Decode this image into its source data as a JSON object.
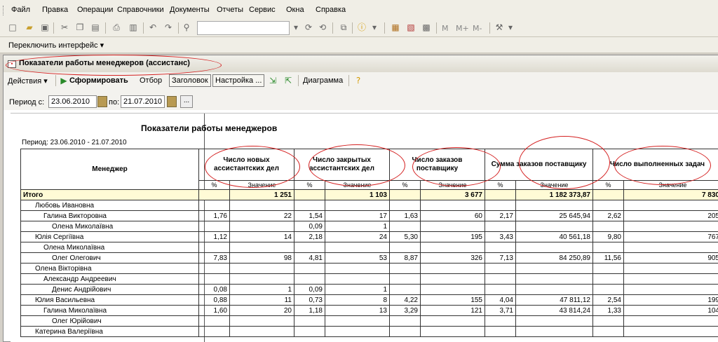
{
  "menu": [
    "Файл",
    "Правка",
    "Операции",
    "Справочники",
    "Документы",
    "Отчеты",
    "Сервис",
    "Окна",
    "Справка"
  ],
  "toolbar": {
    "search_value": "",
    "text_buttons": [
      "M",
      "M+",
      "M-"
    ]
  },
  "switch_interface": "Переключить интерфейс",
  "window": {
    "title": "Показатели работы менеджеров (ассистанс)",
    "actions": {
      "actions_label": "Действия",
      "generate": "Сформировать",
      "filter": "Отбор",
      "header": "Заголовок",
      "settings": "Настройка ...",
      "chart": "Диаграмма"
    },
    "period": {
      "from_label": "Период с:",
      "from": "23.06.2010",
      "to_label": "по:",
      "to": "21.07.2010",
      "more": "..."
    }
  },
  "report": {
    "title": "Показатели работы менеджеров",
    "period": "Период: 23.06.2010 - 21.07.2010",
    "manager_header": "Менеджер",
    "groups": [
      "Число новых ассистантских дел",
      "Число закрытых ассистантских дел",
      "Число заказов поставщику",
      "Сумма заказов поставщику",
      "Число выполненных задач"
    ],
    "sub_pct": "%",
    "sub_val": "Значение",
    "total_label": "Итого",
    "total": [
      "",
      "1 251",
      "",
      "1 103",
      "",
      "3 677",
      "",
      "1 182 373,87",
      "",
      "7 830"
    ],
    "rows": [
      {
        "name": "Любовь Ивановна",
        "v": [
          "",
          "",
          "",
          "",
          "",
          "",
          "",
          "",
          "",
          ""
        ]
      },
      {
        "name": "Галина Викторовна",
        "v": [
          "1,76",
          "22",
          "1,54",
          "17",
          "1,63",
          "60",
          "2,17",
          "25 645,94",
          "2,62",
          "205"
        ]
      },
      {
        "name": "Олена Миколаївна",
        "v": [
          "",
          "",
          "0,09",
          "1",
          "",
          "",
          "",
          "",
          "",
          ""
        ]
      },
      {
        "name": "Юлія Сергіївна",
        "v": [
          "1,12",
          "14",
          "2,18",
          "24",
          "5,30",
          "195",
          "3,43",
          "40 561,18",
          "9,80",
          "767"
        ]
      },
      {
        "name": "Олена Миколаївна",
        "v": [
          "",
          "",
          "",
          "",
          "",
          "",
          "",
          "",
          "",
          ""
        ]
      },
      {
        "name": "Олег Олегович",
        "v": [
          "7,83",
          "98",
          "4,81",
          "53",
          "8,87",
          "326",
          "7,13",
          "84 250,89",
          "11,56",
          "905"
        ]
      },
      {
        "name": "Олена Вікторівна",
        "v": [
          "",
          "",
          "",
          "",
          "",
          "",
          "",
          "",
          "",
          ""
        ]
      },
      {
        "name": "Александр Андреевич",
        "v": [
          "",
          "",
          "",
          "",
          "",
          "",
          "",
          "",
          "",
          ""
        ]
      },
      {
        "name": "Денис Андрійович",
        "v": [
          "0,08",
          "1",
          "0,09",
          "1",
          "",
          "",
          "",
          "",
          "",
          ""
        ]
      },
      {
        "name": "Юлия Васильевна",
        "v": [
          "0,88",
          "11",
          "0,73",
          "8",
          "4,22",
          "155",
          "4,04",
          "47 811,12",
          "2,54",
          "199"
        ]
      },
      {
        "name": "Галина Миколаївна",
        "v": [
          "1,60",
          "20",
          "1,18",
          "13",
          "3,29",
          "121",
          "3,71",
          "43 814,24",
          "1,33",
          "104"
        ]
      },
      {
        "name": "Олег Юрійович",
        "v": [
          "",
          "",
          "",
          "",
          "",
          "",
          "",
          "",
          "",
          ""
        ]
      },
      {
        "name": "Катерина Валеріївна",
        "v": [
          "",
          "",
          "",
          "",
          "",
          "",
          "",
          "",
          "",
          ""
        ]
      }
    ]
  },
  "colors": {
    "highlight": "#d42020",
    "total_bg": "#fffbd6"
  }
}
